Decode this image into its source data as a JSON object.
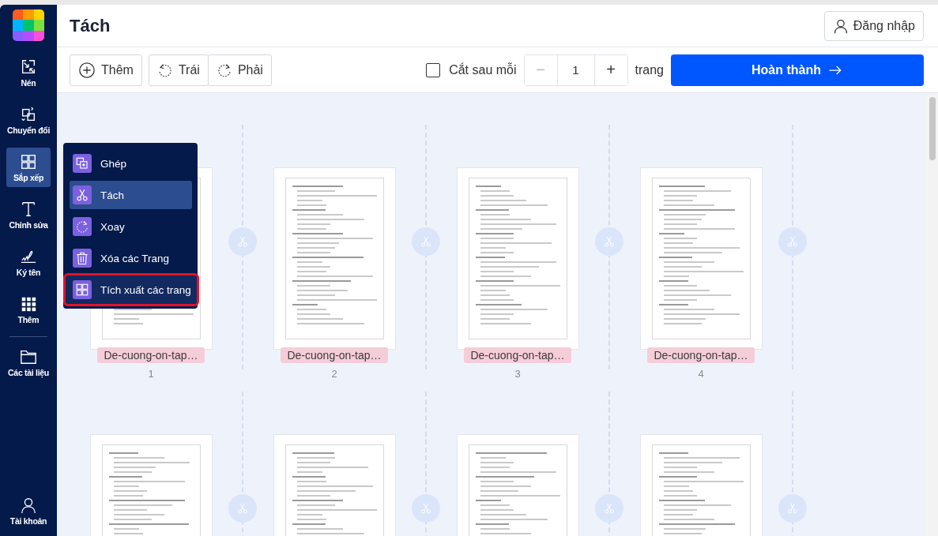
{
  "sidebar": {
    "items": [
      {
        "label": "Nén",
        "selected": false
      },
      {
        "label": "Chuyển đổi",
        "selected": false
      },
      {
        "label": "Sắp xếp",
        "selected": true
      },
      {
        "label": "Chỉnh sửa",
        "selected": false
      },
      {
        "label": "Ký tên",
        "selected": false
      },
      {
        "label": "Thêm",
        "selected": false
      },
      {
        "label": "Các tài liệu",
        "selected": false
      }
    ],
    "account": "Tài khoản"
  },
  "header": {
    "title": "Tách",
    "login": "Đăng nhập"
  },
  "toolbar": {
    "add": "Thêm",
    "rotate_left": "Trái",
    "rotate_right": "Phải",
    "cut_after": {
      "label": "Cắt sau mỗi",
      "checked": false
    },
    "minus": "−",
    "value": "1",
    "plus": "+",
    "unit": "trang",
    "finish": "Hoàn thành"
  },
  "menu": [
    {
      "label": "Ghép",
      "selected": false,
      "highlighted": false
    },
    {
      "label": "Tách",
      "selected": true,
      "highlighted": false
    },
    {
      "label": "Xoay",
      "selected": false,
      "highlighted": false
    },
    {
      "label": "Xóa các Trang",
      "selected": false,
      "highlighted": false
    },
    {
      "label": "Tích xuất các trang",
      "selected": false,
      "highlighted": true
    }
  ],
  "pages": [
    {
      "kind": "labeled",
      "name": "De-cuong-on-tap…",
      "number": "1"
    },
    {
      "kind": "labeled",
      "name": "De-cuong-on-tap…",
      "number": "2"
    },
    {
      "kind": "labeled",
      "name": "De-cuong-on-tap…",
      "number": "3"
    },
    {
      "kind": "labeled",
      "name": "De-cuong-on-tap…",
      "number": "4"
    },
    {
      "kind": "unlabeled"
    },
    {
      "kind": "unlabeled"
    },
    {
      "kind": "unlabeled"
    },
    {
      "kind": "unlabeled"
    }
  ]
}
